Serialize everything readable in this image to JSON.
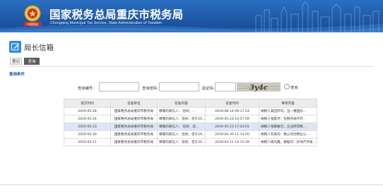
{
  "header": {
    "emblem_text": "中国税务",
    "title_cn": "国家税务总局重庆市税务局",
    "title_en": "Chongqing Municipal Tax Service, State Administration of Taxation",
    "colors": {
      "banner": "#1f5aa8",
      "text": "#ffffff"
    }
  },
  "page": {
    "title": "局长信箱",
    "title_icon": "edit-icon",
    "buttons": {
      "register": "登记",
      "query": "查询"
    },
    "section_label": "查询条件"
  },
  "form": {
    "query_no_label": "查询编号:",
    "query_no_value": "",
    "query_pwd_label": "查询密码:",
    "query_pwd_value": "",
    "captcha_label": "验证码:",
    "captcha_value": "",
    "captcha_text": "3y4c",
    "submit_label": "查询"
  },
  "table": {
    "headers": [
      "提交时间",
      "答复单位",
      "答复内容",
      "答复时间",
      "事项内容"
    ],
    "rows": [
      [
        "2019-05-28",
        "国家税务总局重庆市税务局",
        "尊敬的来信人：    您好，...",
        "2019-06-14 09:17:24",
        "纳税人美团开司，当一重国办..."
      ],
      [
        "2019-05-24",
        "国家税务总局重庆市税务局",
        "尊敬的来信人：您好，您于20...",
        "2019-05-24 10:57:09",
        "纳税人张庭河：在税务局代开..."
      ],
      [
        "2019-05-23",
        "国家税务总局重庆市税务局",
        "尊敬的来信人：    您好，您...",
        "2019-05-23 17:43:01",
        "纳税人张静磁可，企业所得税..."
      ],
      [
        "2019-04-30",
        "国家税务总局重庆市税务局",
        "尊敬的来信人：您好，您于20...",
        "2019-04-30 11:14:20",
        "纳税人刘某问：我公司为物业公..."
      ],
      [
        "2019-04-11",
        "国家税务总局重庆市税务局",
        "尊敬的来信人：您好，您于20...",
        "2019-04-11 14:15:39",
        "纳税人胡马鑫，根据问：房地产开发..."
      ]
    ],
    "highlighted_row": 2
  }
}
